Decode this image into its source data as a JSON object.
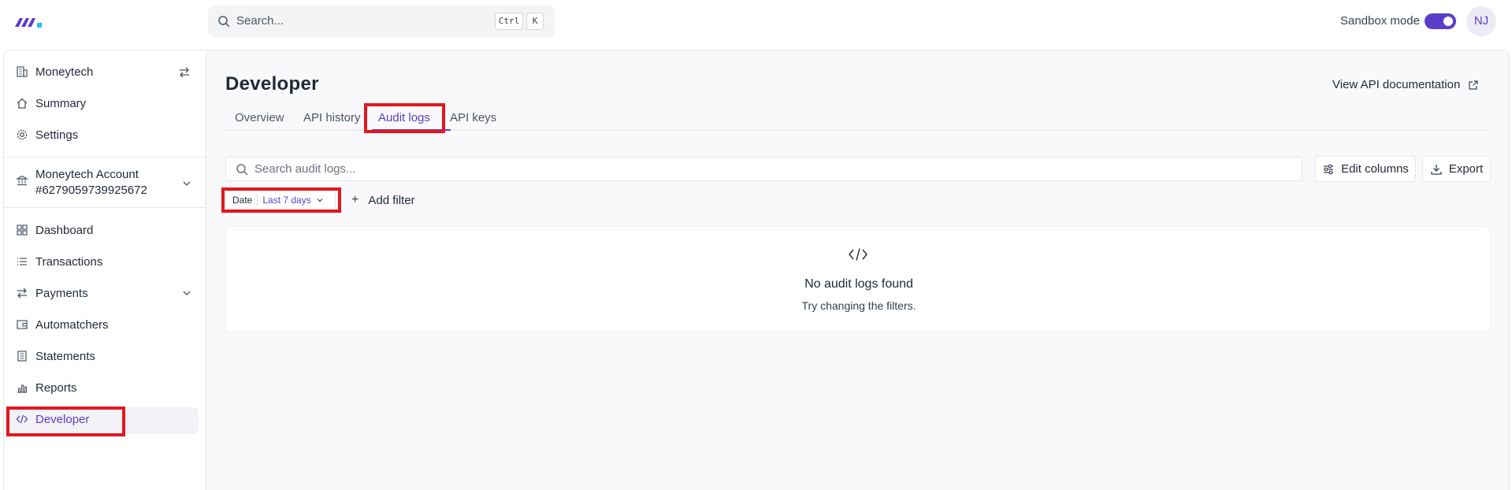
{
  "topbar": {
    "search_placeholder": "Search...",
    "shortcut_ctrl": "Ctrl",
    "shortcut_key": "K",
    "sandbox_label": "Sandbox mode",
    "sandbox_on": true,
    "avatar_initials": "NJ"
  },
  "sidebar": {
    "org_name": "Moneytech",
    "top_items": [
      {
        "label": "Summary",
        "icon": "home-icon"
      },
      {
        "label": "Settings",
        "icon": "gear-icon"
      }
    ],
    "account": {
      "name": "Moneytech Account",
      "number": "#6279059739925672"
    },
    "items": [
      {
        "label": "Dashboard",
        "icon": "grid-icon"
      },
      {
        "label": "Transactions",
        "icon": "list-icon"
      },
      {
        "label": "Payments",
        "icon": "arrows-icon"
      },
      {
        "label": "Automatchers",
        "icon": "wallet-icon"
      },
      {
        "label": "Statements",
        "icon": "document-icon"
      },
      {
        "label": "Reports",
        "icon": "bar-chart-icon"
      },
      {
        "label": "Developer",
        "icon": "code-icon",
        "active": true
      }
    ]
  },
  "main": {
    "title": "Developer",
    "api_doc_link": "View API documentation",
    "tabs": [
      {
        "label": "Overview"
      },
      {
        "label": "API history"
      },
      {
        "label": "Audit logs",
        "active": true
      },
      {
        "label": "API keys"
      }
    ],
    "search_placeholder": "Search audit logs...",
    "edit_columns": "Edit columns",
    "export": "Export",
    "filter": {
      "label": "Date",
      "value": "Last 7 days"
    },
    "add_filter": "Add filter",
    "empty": {
      "title": "No audit logs found",
      "subtitle": "Try changing the filters."
    }
  },
  "colors": {
    "accent": "#5b3ec8",
    "highlight": "#e3171f"
  }
}
